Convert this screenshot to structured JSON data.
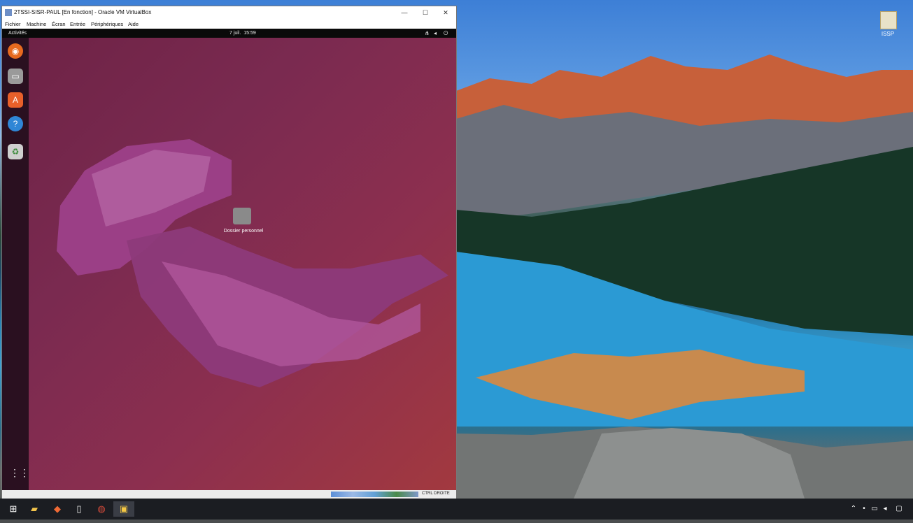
{
  "vbox": {
    "title": "2TSSI-SISR-PAUL [En fonction] - Oracle VM VirtualBox",
    "menu": [
      "Fichier",
      "Machine",
      "Écran",
      "Entrée",
      "Périphériques",
      "Aide"
    ],
    "minimize": "—",
    "maximize": "☐",
    "close": "✕",
    "status_host_key": "CTRL DROITE"
  },
  "ubuntu": {
    "activities": "Activités",
    "clock": "7 juil.  15:59",
    "desktop_icon_label": "Dossier personnel",
    "dock": [
      "firefox-icon",
      "files-icon",
      "software-icon",
      "help-icon",
      "trash-icon"
    ],
    "app_grid_icon": "grid-icon"
  },
  "host": {
    "desktop_icon_label": "ISSP",
    "taskbar_icons": [
      "windows-start-icon",
      "file-explorer-icon",
      "brave-icon",
      "notepad-icon",
      "chrome-like-icon",
      "virtualbox-icon"
    ]
  }
}
